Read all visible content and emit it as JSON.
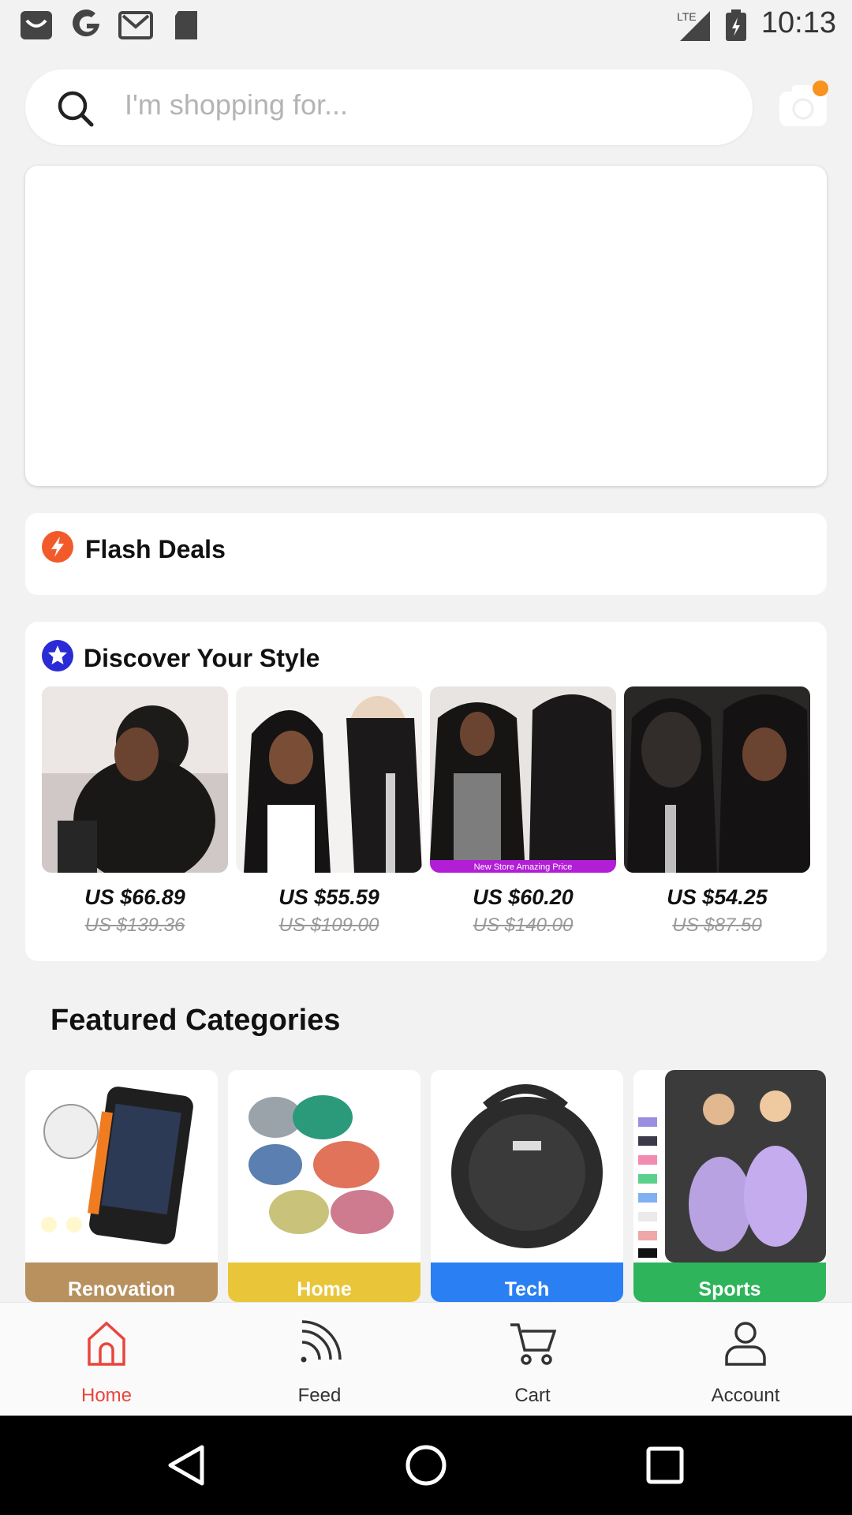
{
  "status": {
    "time": "10:13",
    "network": "LTE"
  },
  "search": {
    "placeholder": "I'm shopping for..."
  },
  "flash_deals": {
    "title": "Flash Deals"
  },
  "discover": {
    "title": "Discover Your Style",
    "products": [
      {
        "price": "US $66.89",
        "old_price": "US $139.36"
      },
      {
        "price": "US $55.59",
        "old_price": "US $109.00"
      },
      {
        "price": "US $60.20",
        "old_price": "US $140.00",
        "ribbon": "New Store Amazing Price"
      },
      {
        "price": "US $54.25",
        "old_price": "US $87.50"
      }
    ]
  },
  "featured": {
    "title": "Featured Categories",
    "categories": [
      {
        "label": "Renovation",
        "color": "#b8915f"
      },
      {
        "label": "Home",
        "color": "#e9c53a"
      },
      {
        "label": "Tech",
        "color": "#2a7ff2"
      },
      {
        "label": "Sports",
        "color": "#2eb45a"
      }
    ]
  },
  "nav": {
    "items": [
      {
        "label": "Home",
        "icon": "home-icon",
        "active": true
      },
      {
        "label": "Feed",
        "icon": "feed-icon"
      },
      {
        "label": "Cart",
        "icon": "cart-icon"
      },
      {
        "label": "Account",
        "icon": "account-icon"
      }
    ]
  },
  "colors": {
    "accent": "#e8453c",
    "flash": "#f25a2a",
    "discover": "#2b2bd6",
    "badge": "#f7931e"
  }
}
